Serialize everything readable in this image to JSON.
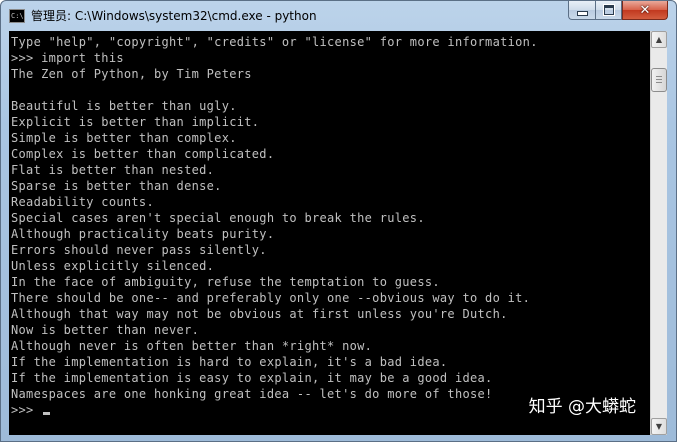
{
  "window": {
    "title": "管理员: C:\\Windows\\system32\\cmd.exe - python",
    "icon": "cmd-app-icon",
    "icon_text": "C:\\"
  },
  "controls": {
    "minimize_icon": "minimize-icon",
    "maximize_icon": "maximize-icon",
    "close_icon": "close-icon",
    "close_glyph": "✕"
  },
  "console": {
    "lines": [
      "Type \"help\", \"copyright\", \"credits\" or \"license\" for more information.",
      ">>> import this",
      "The Zen of Python, by Tim Peters",
      "",
      "Beautiful is better than ugly.",
      "Explicit is better than implicit.",
      "Simple is better than complex.",
      "Complex is better than complicated.",
      "Flat is better than nested.",
      "Sparse is better than dense.",
      "Readability counts.",
      "Special cases aren't special enough to break the rules.",
      "Although practicality beats purity.",
      "Errors should never pass silently.",
      "Unless explicitly silenced.",
      "In the face of ambiguity, refuse the temptation to guess.",
      "There should be one-- and preferably only one --obvious way to do it.",
      "Although that way may not be obvious at first unless you're Dutch.",
      "Now is better than never.",
      "Although never is often better than *right* now.",
      "If the implementation is hard to explain, it's a bad idea.",
      "If the implementation is easy to explain, it may be a good idea.",
      "Namespaces are one honking great idea -- let's do more of those!"
    ],
    "prompt": ">>> ",
    "text_color": "#c0c0c0",
    "background": "#000000"
  },
  "scrollbar": {
    "up_arrow": "▲",
    "down_arrow": "▼"
  },
  "watermark": {
    "text": "知乎 @大蟒蛇"
  }
}
